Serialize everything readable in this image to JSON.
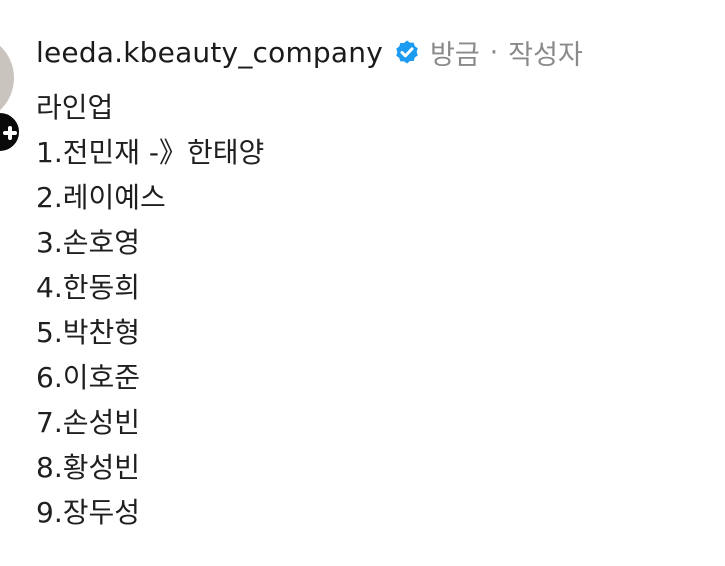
{
  "comment": {
    "username": "leeda.kbeauty_company",
    "verified_icon": "verified-badge-icon",
    "time": "방금",
    "separator": "·",
    "role": "작성자",
    "lines": [
      "라인업",
      "1.전민재 -》한태양",
      "2.레이예스",
      "3.손호영",
      "4.한동희",
      "5.박찬형",
      "6.이호준",
      "7.손성빈",
      "8.황성빈",
      "9.장두성"
    ]
  },
  "follow_icon": "plus-icon",
  "colors": {
    "verified": "#1d9bf0",
    "muted_text": "#8a8a8a",
    "follow_button": "#0a0a0a",
    "avatar_placeholder": "#c9c4be"
  }
}
